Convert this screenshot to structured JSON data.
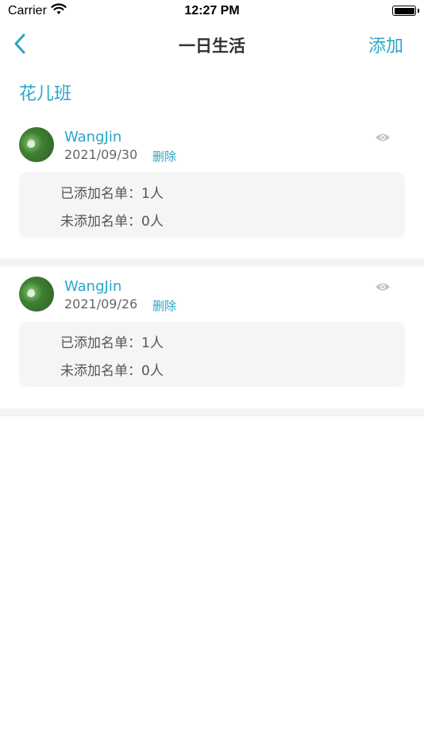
{
  "status_bar": {
    "carrier": "Carrier",
    "time": "12:27 PM"
  },
  "nav": {
    "title": "一日生活",
    "add_label": "添加"
  },
  "class_name": "花儿班",
  "records": [
    {
      "author": "WangJin",
      "date": "2021/09/30",
      "delete_label": "删除",
      "added_list": "已添加名单：1人",
      "not_added_list": "未添加名单：0人"
    },
    {
      "author": "WangJin",
      "date": "2021/09/26",
      "delete_label": "删除",
      "added_list": "已添加名单：1人",
      "not_added_list": "未添加名单：0人"
    }
  ],
  "colors": {
    "accent": "#2aa6c8",
    "info_box": "#f5f5f5",
    "separator": "#f3f3f3"
  },
  "icons": {
    "back": "chevron-left-icon",
    "view": "eye-icon",
    "wifi": "wifi-icon",
    "battery": "battery-icon"
  }
}
